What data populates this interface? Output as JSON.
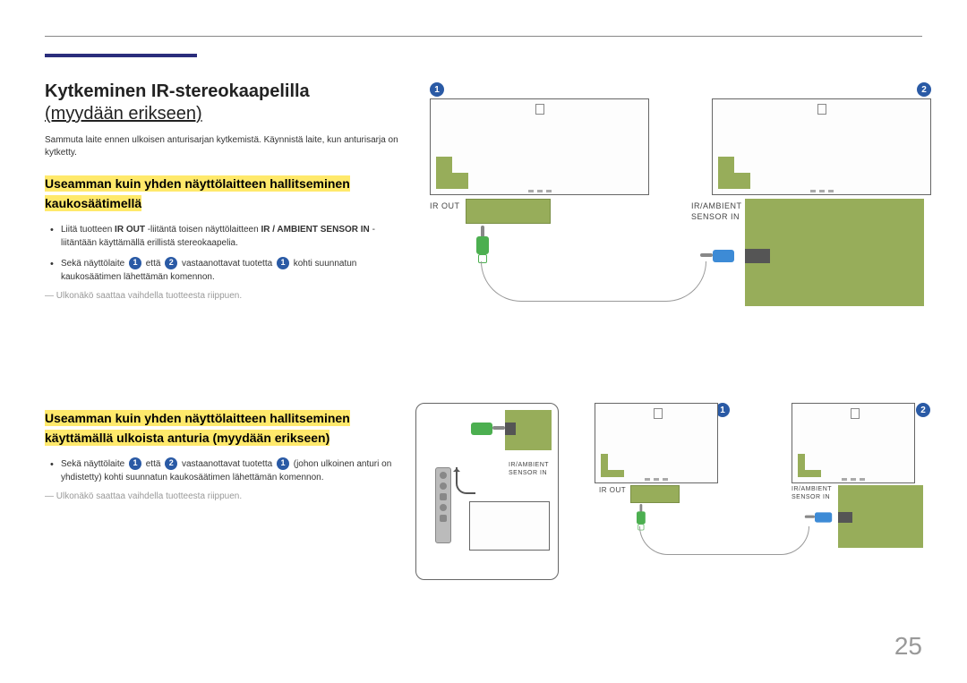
{
  "page_number": "25",
  "title_line1": "Kytkeminen IR-stereokaapelilla",
  "title_line2": "(myydään erikseen)",
  "intro": "Sammuta laite ennen ulkoisen anturisarjan kytkemistä. Käynnistä laite, kun anturisarja on kytketty.",
  "section1_heading": "Useamman kuin yhden näyttölaitteen hallitseminen kaukosäätimellä",
  "bullet1a_pre": "Liitä tuotteen",
  "bullet1a_bold1": "IR OUT",
  "bullet1a_mid": "-liitäntä toisen näyttölaitteen",
  "bullet1a_bold2": "IR / AMBIENT SENSOR IN",
  "bullet1a_post": "-liitäntään käyttämällä erillistä stereokaapelia.",
  "bullet1b_pre": "Sekä näyttölaite",
  "bullet1b_mid1": "että",
  "bullet1b_mid2": "vastaanottavat tuotetta",
  "bullet1b_post": "kohti suunnatun kaukosäätimen lähettämän komennon.",
  "footnote": "Ulkonäkö saattaa vaihdella tuotteesta riippuen.",
  "section2_heading": "Useamman kuin yhden näyttölaitteen hallitseminen käyttämällä ulkoista anturia (myydään erikseen)",
  "bullet2_pre": "Sekä näyttölaite",
  "bullet2_mid1": "että",
  "bullet2_mid2": "vastaanottavat tuotetta",
  "bullet2_paren": "(johon ulkoinen anturi on yhdistetty) kohti suunnatun kaukosäätimen lähettämän komennon.",
  "label_irout": "IR OUT",
  "label_irambient": "IR/AMBIENT",
  "label_sensorin": "SENSOR IN",
  "badges": {
    "one": "1",
    "two": "2"
  }
}
